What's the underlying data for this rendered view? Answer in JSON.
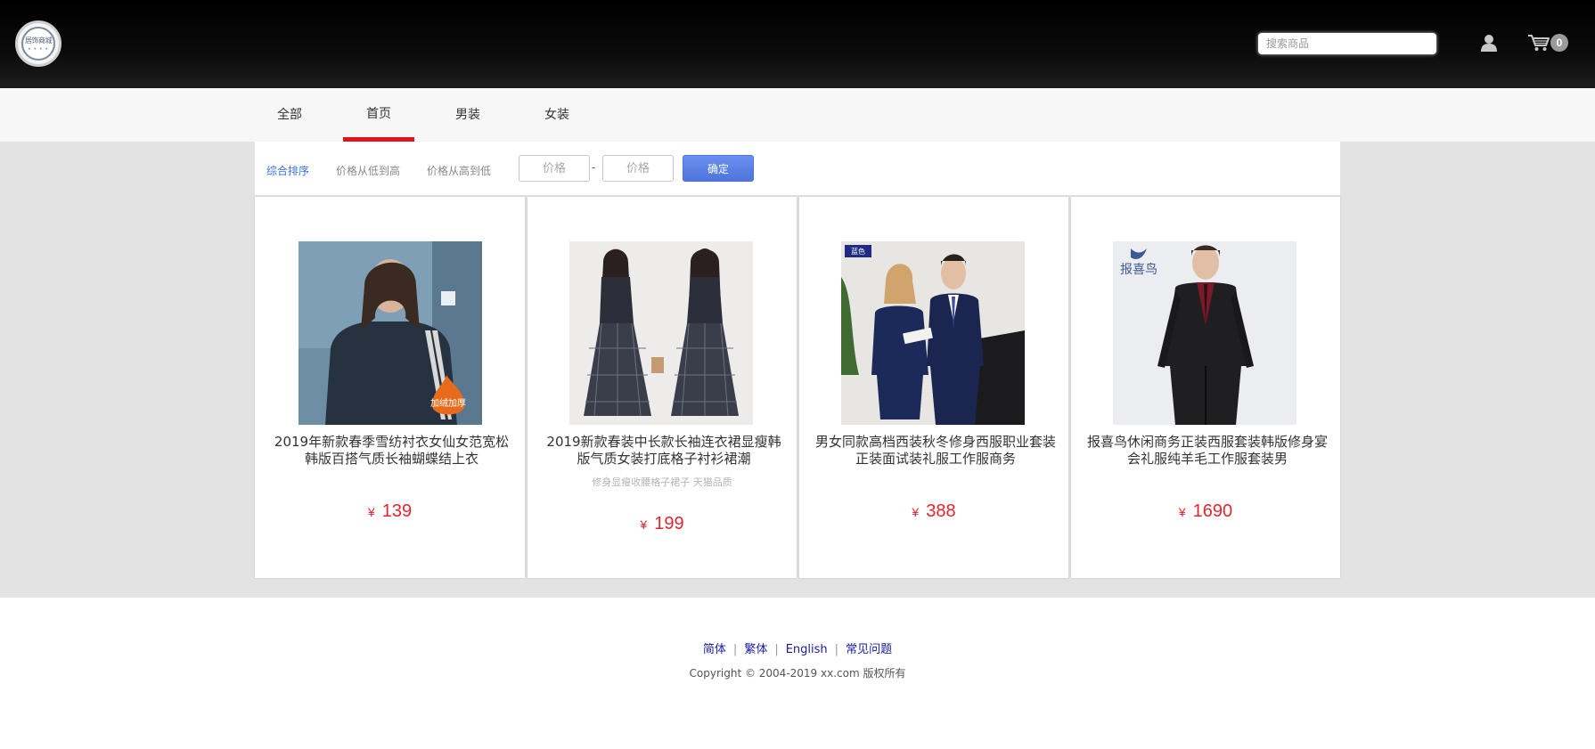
{
  "header": {
    "logo_text": "居饰商城",
    "logo_dots": "● ● ● ●",
    "search_placeholder": "搜索商品",
    "cart_count": "0"
  },
  "nav": {
    "items": [
      {
        "label": "全部",
        "active": false
      },
      {
        "label": "首页",
        "active": true
      },
      {
        "label": "男装",
        "active": false
      },
      {
        "label": "女装",
        "active": false
      }
    ],
    "accent_color": "#e0141b"
  },
  "sort": {
    "options": [
      "综合排序",
      "价格从低到高",
      "价格从高到低"
    ],
    "active_index": 0,
    "price_min_placeholder": "价格",
    "price_max_placeholder": "价格",
    "dash": "-",
    "confirm_label": "确定"
  },
  "products": [
    {
      "title": "2019年新款春季雪纺衬衣女仙女范宽松韩版百搭气质长袖蝴蝶结上衣",
      "subtitle": "",
      "currency": "¥",
      "price": "139",
      "image_badge": "加绒加厚"
    },
    {
      "title": "2019新款春装中长款长袖连衣裙显瘦韩版气质女装打底格子衬衫裙潮",
      "subtitle": "修身显瘦收腰格子裙子 天猫品质",
      "currency": "¥",
      "price": "199",
      "image_badge": ""
    },
    {
      "title": "男女同款高档西装秋冬修身西服职业套装正装面试装礼服工作服商务",
      "subtitle": "",
      "currency": "¥",
      "price": "388",
      "image_badge": "蓝色"
    },
    {
      "title": "报喜鸟休闲商务正装西服套装韩版修身宴会礼服纯羊毛工作服套装男",
      "subtitle": "",
      "currency": "¥",
      "price": "1690",
      "image_badge": "报喜鸟"
    }
  ],
  "footer": {
    "links": [
      "简体",
      "繁体",
      "English",
      "常见问题"
    ],
    "copyright": "Copyright © 2004-2019 xx.com 版权所有"
  }
}
